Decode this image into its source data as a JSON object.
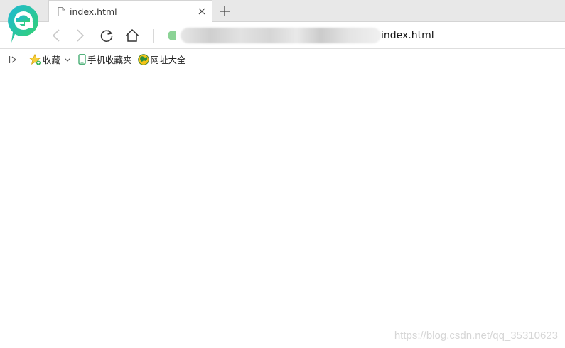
{
  "tab": {
    "title": "index.html",
    "icon": "file-icon",
    "close_icon": "close-icon"
  },
  "toolbar": {
    "back_icon": "back-arrow-icon",
    "forward_icon": "forward-arrow-icon",
    "reload_icon": "reload-icon",
    "home_icon": "home-icon",
    "url_visible": "index.html"
  },
  "bookmarks_bar": {
    "toggle_icon": "sidebar-toggle-icon",
    "items": [
      {
        "label": "收藏",
        "icon": "star-icon"
      },
      {
        "label": "手机收藏夹",
        "icon": "phone-icon"
      },
      {
        "label": "网址大全",
        "icon": "globe-icon"
      }
    ]
  },
  "watermark": "https://blog.csdn.net/qq_35310623",
  "colors": {
    "brand_green": "#2fc27a",
    "tabstrip_bg": "#e8e8e8",
    "page_bg": "#ffffff"
  }
}
